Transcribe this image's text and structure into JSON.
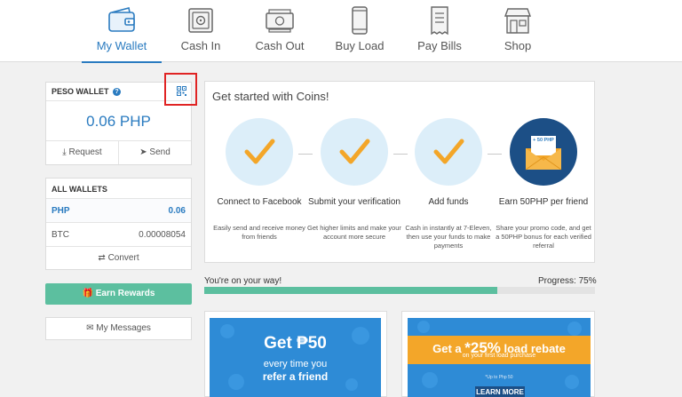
{
  "nav": [
    {
      "label": "My Wallet",
      "icon": "wallet-icon",
      "active": true
    },
    {
      "label": "Cash In",
      "icon": "safe-icon"
    },
    {
      "label": "Cash Out",
      "icon": "cash-icon"
    },
    {
      "label": "Buy Load",
      "icon": "phone-icon"
    },
    {
      "label": "Pay Bills",
      "icon": "bill-icon"
    },
    {
      "label": "Shop",
      "icon": "store-icon"
    }
  ],
  "peso_wallet": {
    "title": "PESO WALLET",
    "help_icon": "question-icon",
    "qr_icon": "qr-code-icon",
    "balance": "0.06 PHP",
    "request_label": "Request",
    "send_label": "Send"
  },
  "all_wallets": {
    "title": "ALL WALLETS",
    "rows": [
      {
        "currency": "PHP",
        "amount": "0.06"
      },
      {
        "currency": "BTC",
        "amount": "0.00008054"
      }
    ],
    "convert_label": "Convert"
  },
  "earn_rewards_label": "Earn Rewards",
  "my_messages_label": "My Messages",
  "get_started": {
    "title": "Get started with Coins!",
    "steps": [
      {
        "title": "Connect to Facebook",
        "desc": "Easily send and receive money from friends"
      },
      {
        "title": "Submit your verification",
        "desc": "Get higher limits and make your account more secure"
      },
      {
        "title": "Add funds",
        "desc": "Cash in instantly at 7-Eleven, then use your funds to make payments"
      },
      {
        "title": "Earn 50PHP per friend",
        "desc": "Share your promo code, and get a 50PHP bonus for each verified referral",
        "badge": "+ 50 PHP"
      }
    ]
  },
  "progress": {
    "text": "You're on your way!",
    "label": "Progress: 75%",
    "fraction": 0.75
  },
  "banners": {
    "referral": {
      "line1": "Get ₱50",
      "line2": "every time you",
      "line3": "refer a friend"
    },
    "load": {
      "prefix": "Get a ",
      "highlight": "*25%",
      "suffix": " load rebate",
      "sub": "on your first load purchase",
      "note": "*Up to Php 50",
      "button": "LEARN MORE ›"
    }
  },
  "colors": {
    "accent": "#2a7bc0",
    "green": "#5cbf9f",
    "orange": "#f3a629",
    "highlight": "#e02424"
  }
}
